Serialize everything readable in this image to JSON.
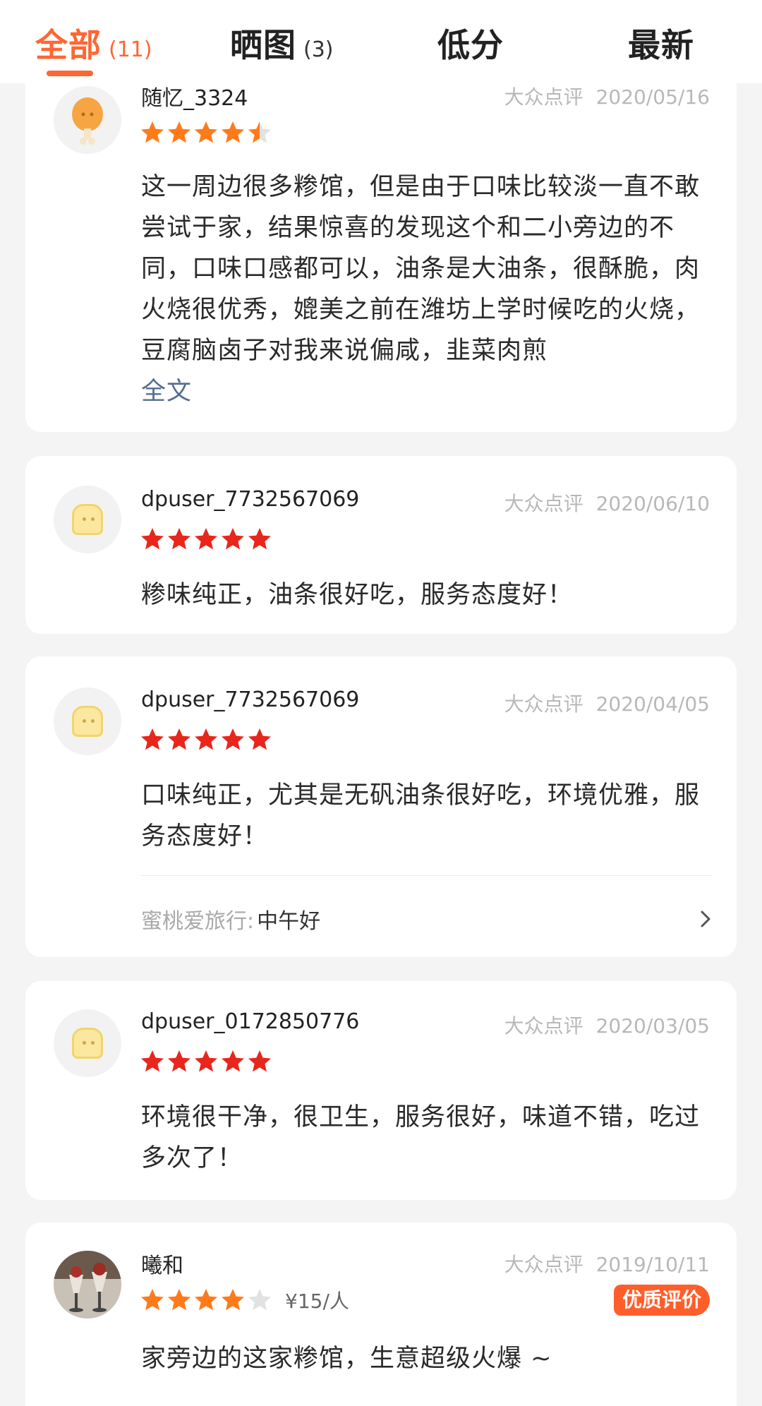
{
  "colors": {
    "accent": "#ff6633",
    "star_orange": "#ff7a1a",
    "star_red": "#e8261c",
    "star_empty": "#e2e2e2"
  },
  "tabs": [
    {
      "label": "全部",
      "count": "(11)",
      "active": true
    },
    {
      "label": "晒图",
      "count": "(3)"
    },
    {
      "label": "低分",
      "count": ""
    },
    {
      "label": "最新",
      "count": ""
    }
  ],
  "reviews": [
    {
      "user": "随忆_3324",
      "source": "大众点评",
      "date": "2020/05/16",
      "rating": 4.5,
      "star_color": "orange",
      "content": "这一周边很多糁馆，但是由于口味比较淡一直不敢尝试于家，结果惊喜的发现这个和二小旁边的不同，口味口感都可以，油条是大油条，很酥脆，肉火烧很优秀，媲美之前在潍坊上学时候吃的火烧，豆腐脑卤子对我来说偏咸，韭菜肉煎",
      "more": "全文"
    },
    {
      "user": "dpuser_7732567069",
      "source": "大众点评",
      "date": "2020/06/10",
      "rating": 5,
      "star_color": "red",
      "content": "糁味纯正，油条很好吃，服务态度好！"
    },
    {
      "user": "dpuser_7732567069",
      "source": "大众点评",
      "date": "2020/04/05",
      "rating": 5,
      "star_color": "red",
      "content": "口味纯正，尤其是无矾油条很好吃，环境优雅，服务态度好！",
      "reply": {
        "author": "蜜桃爱旅行:",
        "text": "中午好"
      }
    },
    {
      "user": "dpuser_0172850776",
      "source": "大众点评",
      "date": "2020/03/05",
      "rating": 5,
      "star_color": "red",
      "content": "环境很干净，很卫生，服务很好，味道不错，吃过多次了！"
    },
    {
      "user": "曦和",
      "source": "大众点评",
      "date": "2019/10/11",
      "rating": 4,
      "star_color": "orange",
      "price": "¥15/人",
      "badge": "优质评价",
      "content": "家旁边的这家糁馆，生意超级火爆 ~"
    }
  ]
}
